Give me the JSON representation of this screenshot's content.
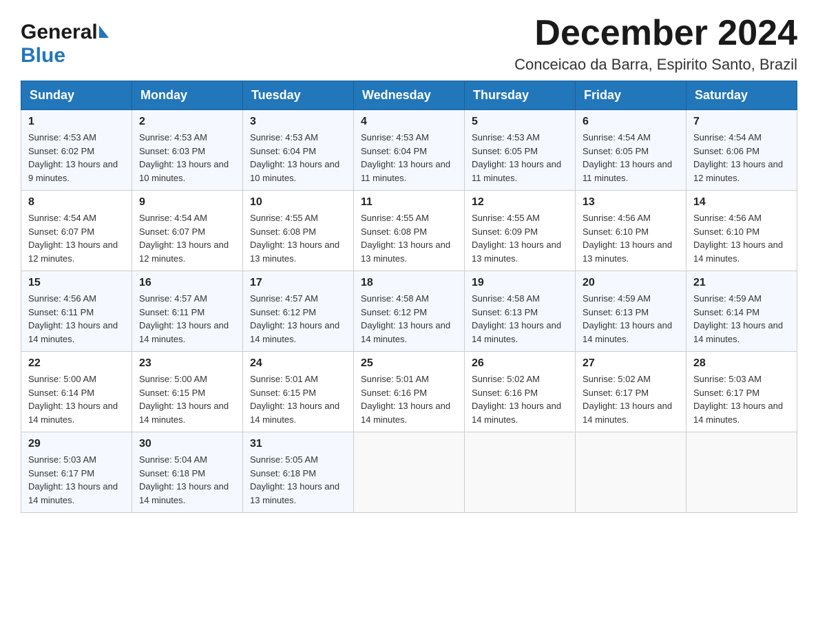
{
  "header": {
    "logo_general": "General",
    "logo_blue": "Blue",
    "month_title": "December 2024",
    "location": "Conceicao da Barra, Espirito Santo, Brazil"
  },
  "days_of_week": [
    "Sunday",
    "Monday",
    "Tuesday",
    "Wednesday",
    "Thursday",
    "Friday",
    "Saturday"
  ],
  "weeks": [
    [
      {
        "day": "1",
        "sunrise": "4:53 AM",
        "sunset": "6:02 PM",
        "daylight": "13 hours and 9 minutes."
      },
      {
        "day": "2",
        "sunrise": "4:53 AM",
        "sunset": "6:03 PM",
        "daylight": "13 hours and 10 minutes."
      },
      {
        "day": "3",
        "sunrise": "4:53 AM",
        "sunset": "6:04 PM",
        "daylight": "13 hours and 10 minutes."
      },
      {
        "day": "4",
        "sunrise": "4:53 AM",
        "sunset": "6:04 PM",
        "daylight": "13 hours and 11 minutes."
      },
      {
        "day": "5",
        "sunrise": "4:53 AM",
        "sunset": "6:05 PM",
        "daylight": "13 hours and 11 minutes."
      },
      {
        "day": "6",
        "sunrise": "4:54 AM",
        "sunset": "6:05 PM",
        "daylight": "13 hours and 11 minutes."
      },
      {
        "day": "7",
        "sunrise": "4:54 AM",
        "sunset": "6:06 PM",
        "daylight": "13 hours and 12 minutes."
      }
    ],
    [
      {
        "day": "8",
        "sunrise": "4:54 AM",
        "sunset": "6:07 PM",
        "daylight": "13 hours and 12 minutes."
      },
      {
        "day": "9",
        "sunrise": "4:54 AM",
        "sunset": "6:07 PM",
        "daylight": "13 hours and 12 minutes."
      },
      {
        "day": "10",
        "sunrise": "4:55 AM",
        "sunset": "6:08 PM",
        "daylight": "13 hours and 13 minutes."
      },
      {
        "day": "11",
        "sunrise": "4:55 AM",
        "sunset": "6:08 PM",
        "daylight": "13 hours and 13 minutes."
      },
      {
        "day": "12",
        "sunrise": "4:55 AM",
        "sunset": "6:09 PM",
        "daylight": "13 hours and 13 minutes."
      },
      {
        "day": "13",
        "sunrise": "4:56 AM",
        "sunset": "6:10 PM",
        "daylight": "13 hours and 13 minutes."
      },
      {
        "day": "14",
        "sunrise": "4:56 AM",
        "sunset": "6:10 PM",
        "daylight": "13 hours and 14 minutes."
      }
    ],
    [
      {
        "day": "15",
        "sunrise": "4:56 AM",
        "sunset": "6:11 PM",
        "daylight": "13 hours and 14 minutes."
      },
      {
        "day": "16",
        "sunrise": "4:57 AM",
        "sunset": "6:11 PM",
        "daylight": "13 hours and 14 minutes."
      },
      {
        "day": "17",
        "sunrise": "4:57 AM",
        "sunset": "6:12 PM",
        "daylight": "13 hours and 14 minutes."
      },
      {
        "day": "18",
        "sunrise": "4:58 AM",
        "sunset": "6:12 PM",
        "daylight": "13 hours and 14 minutes."
      },
      {
        "day": "19",
        "sunrise": "4:58 AM",
        "sunset": "6:13 PM",
        "daylight": "13 hours and 14 minutes."
      },
      {
        "day": "20",
        "sunrise": "4:59 AM",
        "sunset": "6:13 PM",
        "daylight": "13 hours and 14 minutes."
      },
      {
        "day": "21",
        "sunrise": "4:59 AM",
        "sunset": "6:14 PM",
        "daylight": "13 hours and 14 minutes."
      }
    ],
    [
      {
        "day": "22",
        "sunrise": "5:00 AM",
        "sunset": "6:14 PM",
        "daylight": "13 hours and 14 minutes."
      },
      {
        "day": "23",
        "sunrise": "5:00 AM",
        "sunset": "6:15 PM",
        "daylight": "13 hours and 14 minutes."
      },
      {
        "day": "24",
        "sunrise": "5:01 AM",
        "sunset": "6:15 PM",
        "daylight": "13 hours and 14 minutes."
      },
      {
        "day": "25",
        "sunrise": "5:01 AM",
        "sunset": "6:16 PM",
        "daylight": "13 hours and 14 minutes."
      },
      {
        "day": "26",
        "sunrise": "5:02 AM",
        "sunset": "6:16 PM",
        "daylight": "13 hours and 14 minutes."
      },
      {
        "day": "27",
        "sunrise": "5:02 AM",
        "sunset": "6:17 PM",
        "daylight": "13 hours and 14 minutes."
      },
      {
        "day": "28",
        "sunrise": "5:03 AM",
        "sunset": "6:17 PM",
        "daylight": "13 hours and 14 minutes."
      }
    ],
    [
      {
        "day": "29",
        "sunrise": "5:03 AM",
        "sunset": "6:17 PM",
        "daylight": "13 hours and 14 minutes."
      },
      {
        "day": "30",
        "sunrise": "5:04 AM",
        "sunset": "6:18 PM",
        "daylight": "13 hours and 14 minutes."
      },
      {
        "day": "31",
        "sunrise": "5:05 AM",
        "sunset": "6:18 PM",
        "daylight": "13 hours and 13 minutes."
      },
      null,
      null,
      null,
      null
    ]
  ]
}
